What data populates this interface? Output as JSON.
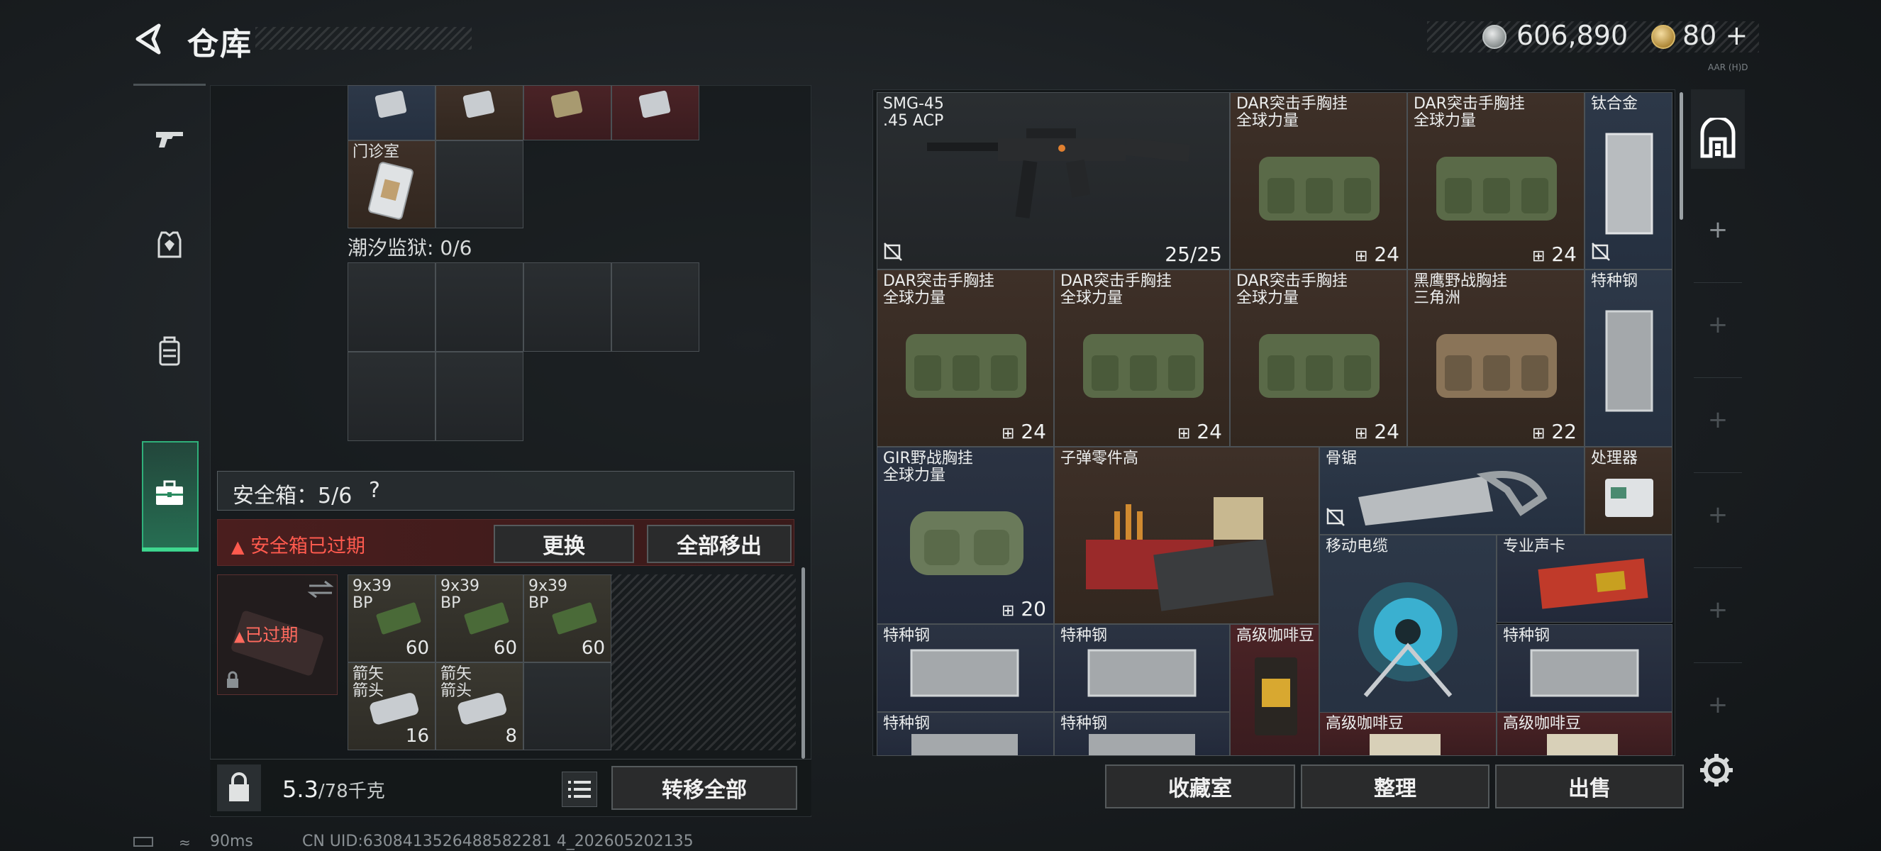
{
  "header": {
    "title": "仓库",
    "coin_value": "606,890",
    "gold_value": "80",
    "gold_plus": "+",
    "tiny_label": "AAR (H)D"
  },
  "left_panel": {
    "clinic_label": "门诊室",
    "prison_label": "潮汐监狱: 0/6",
    "safebox_label": "安全箱：5/6",
    "safebox_help": "?",
    "expired_warning": "安全箱已过期",
    "replace_button": "更换",
    "remove_all_button": "全部移出",
    "safebox_expired_tag": "已过期",
    "safebox_items": [
      {
        "label": "9x39\nBP",
        "count": "60"
      },
      {
        "label": "9x39\nBP",
        "count": "60"
      },
      {
        "label": "9x39\nBP",
        "count": "60"
      },
      {
        "label": "箭矢\n箭头",
        "count": "16"
      },
      {
        "label": "箭矢\n箭头",
        "count": "8"
      }
    ],
    "weight_value": "5.3",
    "weight_max": "/78千克",
    "transfer_all_button": "转移全部"
  },
  "status_bar": {
    "ping": "90ms",
    "uid": "CN UID:6308413526488582281 4_202605202135"
  },
  "right_panel": {
    "items": [
      {
        "name": "SMG-45\n.45 ACP",
        "count": "25/25"
      },
      {
        "name": "DAR突击手胸挂\n全球力量",
        "count": "24"
      },
      {
        "name": "DAR突击手胸挂\n全球力量",
        "count": "24"
      },
      {
        "name": "钛合金",
        "count": ""
      },
      {
        "name": "DAR突击手胸挂\n全球力量",
        "count": "24"
      },
      {
        "name": "DAR突击手胸挂\n全球力量",
        "count": "24"
      },
      {
        "name": "DAR突击手胸挂\n全球力量",
        "count": "24"
      },
      {
        "name": "黑鹰野战胸挂\n三角洲",
        "count": "22"
      },
      {
        "name": "特种钢",
        "count": ""
      },
      {
        "name": "GIR野战胸挂\n全球力量",
        "count": "20"
      },
      {
        "name": "子弹零件高",
        "count": ""
      },
      {
        "name": "骨锯",
        "count": ""
      },
      {
        "name": "处理器",
        "count": ""
      },
      {
        "name": "移动电缆",
        "count": ""
      },
      {
        "name": "专业声卡",
        "count": ""
      },
      {
        "name": "特种钢",
        "count": ""
      },
      {
        "name": "特种钢",
        "count": ""
      },
      {
        "name": "高级咖啡豆",
        "count": ""
      },
      {
        "name": "特种钢",
        "count": ""
      },
      {
        "name": "特种钢",
        "count": ""
      },
      {
        "name": "特种钢",
        "count": ""
      },
      {
        "name": "高级咖啡豆",
        "count": ""
      },
      {
        "name": "高级咖啡豆",
        "count": ""
      }
    ]
  },
  "bottom_buttons": {
    "collection": "收藏室",
    "organize": "整理",
    "sell": "出售"
  },
  "sidebar": {
    "plus": "+"
  },
  "colors": {
    "accent_green": "#2fb07a",
    "warning_red": "#ff5a4e",
    "panel_blue": "#2b3342",
    "panel_brown": "#3e3028"
  }
}
